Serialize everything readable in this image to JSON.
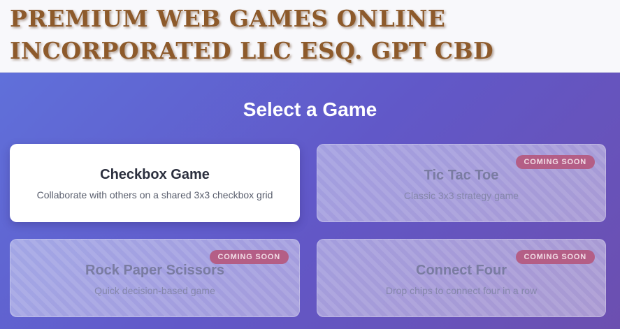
{
  "header": {
    "site_title": "Premium Web Games Online Incorporated LLC Esq. GPT CBD"
  },
  "main": {
    "section_title": "Select a Game",
    "games": [
      {
        "title": "Checkbox Game",
        "description": "Collaborate with others on a shared 3x3 checkbox grid",
        "available": true
      },
      {
        "title": "Tic Tac Toe",
        "description": "Classic 3x3 strategy game",
        "badge": "COMING SOON",
        "available": false
      },
      {
        "title": "Rock Paper Scissors",
        "description": "Quick decision-based game",
        "badge": "COMING SOON",
        "available": false
      },
      {
        "title": "Connect Four",
        "description": "Drop chips to connect four in a row",
        "badge": "COMING SOON",
        "available": false
      }
    ]
  },
  "colors": {
    "title_brown": "#8d5a2b",
    "gradient_start": "#6070da",
    "gradient_end": "#6c4fb0",
    "badge_bg": "#b45e86"
  }
}
